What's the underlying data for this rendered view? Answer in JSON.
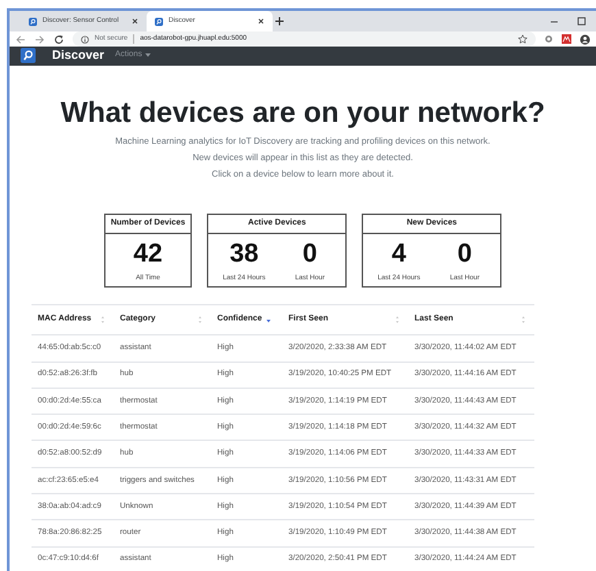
{
  "browser": {
    "tabs": [
      {
        "title": "Discover: Sensor Control",
        "selected": false
      },
      {
        "title": "Discover",
        "selected": true
      }
    ],
    "security": "Not secure",
    "url": "aos-datarobot-gpu.jhuapl.edu:5000"
  },
  "navbar": {
    "brand": "Discover",
    "menu": "Actions"
  },
  "heading": "What devices are on your network?",
  "intro": [
    "Machine Learning analytics for IoT Discovery are tracking and profiling devices on this network.",
    "New devices will appear in this list as they are detected.",
    "Click on a device below to learn more about it."
  ],
  "cards": [
    {
      "title": "Number of Devices",
      "stats": [
        {
          "value": "42",
          "label": "All Time"
        }
      ]
    },
    {
      "title": "Active Devices",
      "stats": [
        {
          "value": "38",
          "label": "Last 24 Hours"
        },
        {
          "value": "0",
          "label": "Last Hour"
        }
      ]
    },
    {
      "title": "New Devices",
      "stats": [
        {
          "value": "4",
          "label": "Last 24 Hours"
        },
        {
          "value": "0",
          "label": "Last Hour"
        }
      ]
    }
  ],
  "table": {
    "columns": [
      {
        "label": "MAC Address",
        "sorted": false
      },
      {
        "label": "Category",
        "sorted": false
      },
      {
        "label": "Confidence",
        "sorted": true
      },
      {
        "label": "First Seen",
        "sorted": false
      },
      {
        "label": "Last Seen",
        "sorted": false
      }
    ],
    "rows": [
      [
        "44:65:0d:ab:5c:c0",
        "assistant",
        "High",
        "3/20/2020, 2:33:38 AM EDT",
        "3/30/2020, 11:44:02 AM EDT"
      ],
      [
        "d0:52:a8:26:3f:fb",
        "hub",
        "High",
        "3/19/2020, 10:40:25 PM EDT",
        "3/30/2020, 11:44:16 AM EDT"
      ],
      [
        "00:d0:2d:4e:55:ca",
        "thermostat",
        "High",
        "3/19/2020, 1:14:19 PM EDT",
        "3/30/2020, 11:44:43 AM EDT"
      ],
      [
        "00:d0:2d:4e:59:6c",
        "thermostat",
        "High",
        "3/19/2020, 1:14:18 PM EDT",
        "3/30/2020, 11:44:32 AM EDT"
      ],
      [
        "d0:52:a8:00:52:d9",
        "hub",
        "High",
        "3/19/2020, 1:14:06 PM EDT",
        "3/30/2020, 11:44:33 AM EDT"
      ],
      [
        "ac:cf:23:65:e5:e4",
        "triggers and switches",
        "High",
        "3/19/2020, 1:10:56 PM EDT",
        "3/30/2020, 11:43:31 AM EDT"
      ],
      [
        "38:0a:ab:04:ad:c9",
        "Unknown",
        "High",
        "3/19/2020, 1:10:54 PM EDT",
        "3/30/2020, 11:44:39 AM EDT"
      ],
      [
        "78:8a:20:86:82:25",
        "router",
        "High",
        "3/19/2020, 1:10:49 PM EDT",
        "3/30/2020, 11:44:38 AM EDT"
      ],
      [
        "0c:47:c9:10:d4:6f",
        "assistant",
        "High",
        "3/20/2020, 2:50:41 PM EDT",
        "3/30/2020, 11:44:24 AM EDT"
      ]
    ]
  }
}
